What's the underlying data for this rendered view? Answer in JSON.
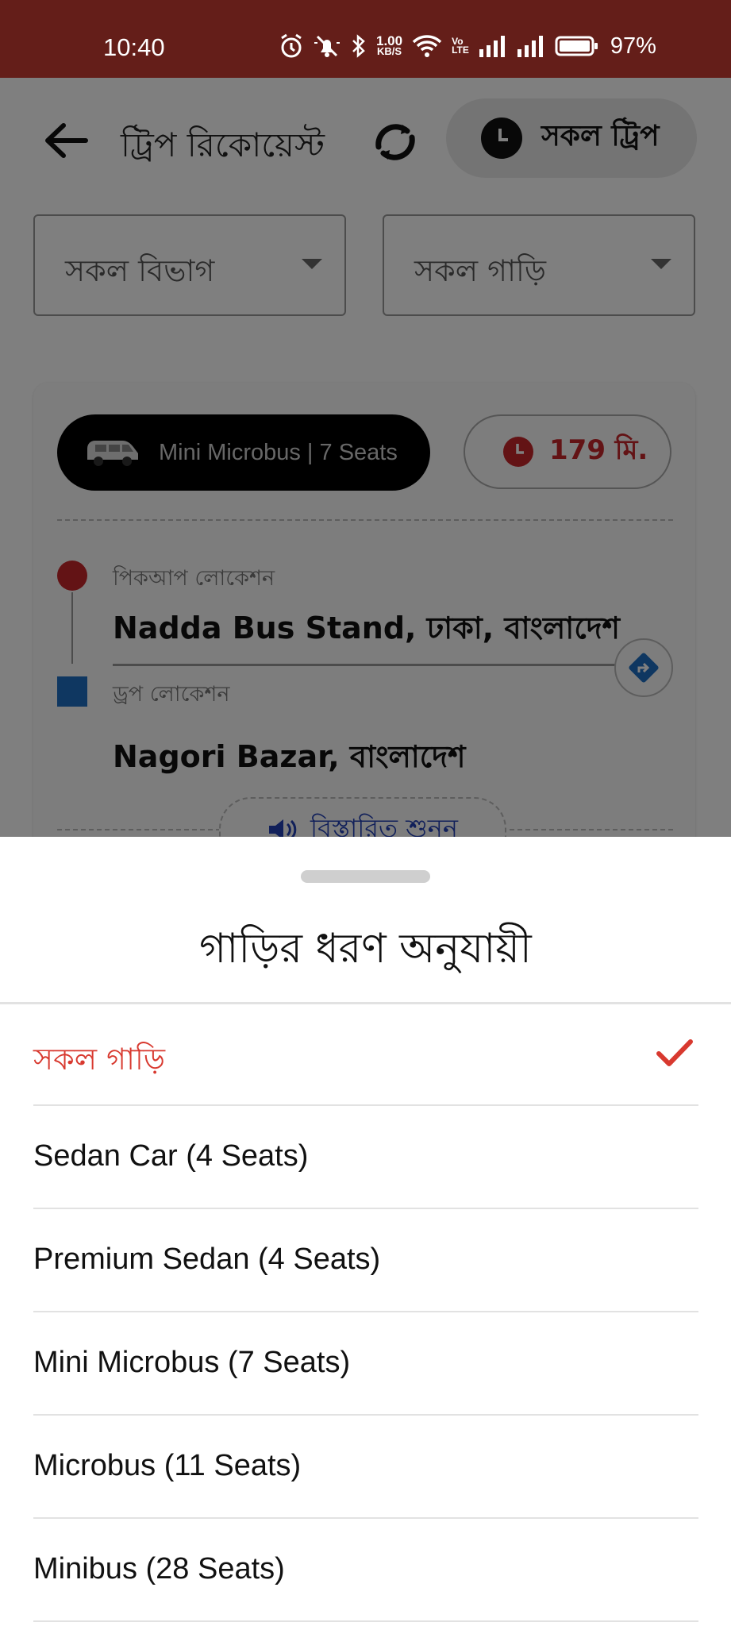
{
  "status_bar": {
    "time": "10:40",
    "net_speed_value": "1.00",
    "net_speed_unit": "KB/S",
    "volte_top": "Vo",
    "volte_bottom": "LTE",
    "battery": "97%"
  },
  "app_bar": {
    "title": "ট্রিপ রিকোয়েস্ট",
    "all_trips_label": "সকল ট্রিপ"
  },
  "filters": {
    "division": "সকল বিভাগ",
    "vehicle": "সকল গাড়ি"
  },
  "trip_card": {
    "vehicle_label": "Mini Microbus | 7 Seats",
    "time_label": "179 মি.",
    "pickup_caption": "পিকআপ লোকেশন",
    "pickup_name": "Nadda Bus Stand, ঢাকা, বাংলাদেশ",
    "drop_caption": "ড্রপ লোকেশন",
    "drop_name": "Nagori Bazar, বাংলাদেশ",
    "listen_label": "বিস্তারিত শুনুন"
  },
  "sheet": {
    "title": "গাড়ির ধরণ অনুযায়ী",
    "options": [
      {
        "label": "সকল গাড়ি",
        "selected": true
      },
      {
        "label": "Sedan Car (4 Seats)",
        "selected": false
      },
      {
        "label": "Premium Sedan (4 Seats)",
        "selected": false
      },
      {
        "label": "Mini Microbus (7 Seats)",
        "selected": false
      },
      {
        "label": "Microbus (11 Seats)",
        "selected": false
      },
      {
        "label": "Minibus (28 Seats)",
        "selected": false
      }
    ]
  },
  "colors": {
    "status_bar": "#641e19",
    "accent_red": "#d8392f",
    "drop_blue": "#1e6fc2",
    "listen_blue": "#2340b5"
  },
  "icons": [
    "back-arrow-icon",
    "refresh-icon",
    "clock-icon",
    "van-icon",
    "navigation-icon",
    "speaker-icon",
    "check-icon"
  ]
}
